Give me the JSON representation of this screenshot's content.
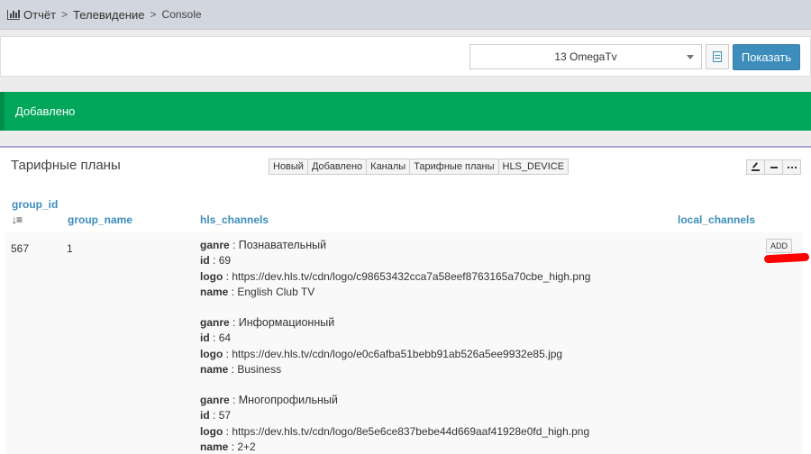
{
  "breadcrumb": {
    "items": [
      "Отчёт",
      "Телевидение",
      "Console"
    ],
    "separator": ">"
  },
  "toolbar": {
    "select_value": "13 OmegaTv",
    "show_label": "Показать"
  },
  "alert": {
    "text": "Добавлено",
    "color": "#00a65a"
  },
  "box": {
    "title": "Тарифные планы",
    "tabs": [
      "Новый",
      "Добавлено",
      "Каналы",
      "Тарифные планы",
      "HLS_DEVICE"
    ]
  },
  "table": {
    "columns": [
      "group_id",
      "group_name",
      "hls_channels",
      "local_channels"
    ],
    "row": {
      "group_id": "567",
      "group_name": "1",
      "add_label": "ADD",
      "channels": [
        {
          "ganre": "Познавательный",
          "id": "69",
          "logo": "https://dev.hls.tv/cdn/logo/c98653432cca7a58eef8763165a70cbe_high.png",
          "name": "English Club TV"
        },
        {
          "ganre": "Информационный",
          "id": "64",
          "logo": "https://dev.hls.tv/cdn/logo/e0c6afba51bebb91ab526a5ee9932e85.jpg",
          "name": "Business"
        },
        {
          "ganre": "Многопрофильный",
          "id": "57",
          "logo": "https://dev.hls.tv/cdn/logo/8e5e6ce837bebe44d669aaf41928e0fd_high.png",
          "name": "2+2"
        }
      ]
    }
  },
  "field_labels": {
    "ganre": "ganre",
    "id": "id",
    "logo": "logo",
    "name": "name"
  },
  "colors": {
    "accent": "#3c8dbc",
    "success": "#00a65a",
    "highlight": "#ff0000"
  }
}
